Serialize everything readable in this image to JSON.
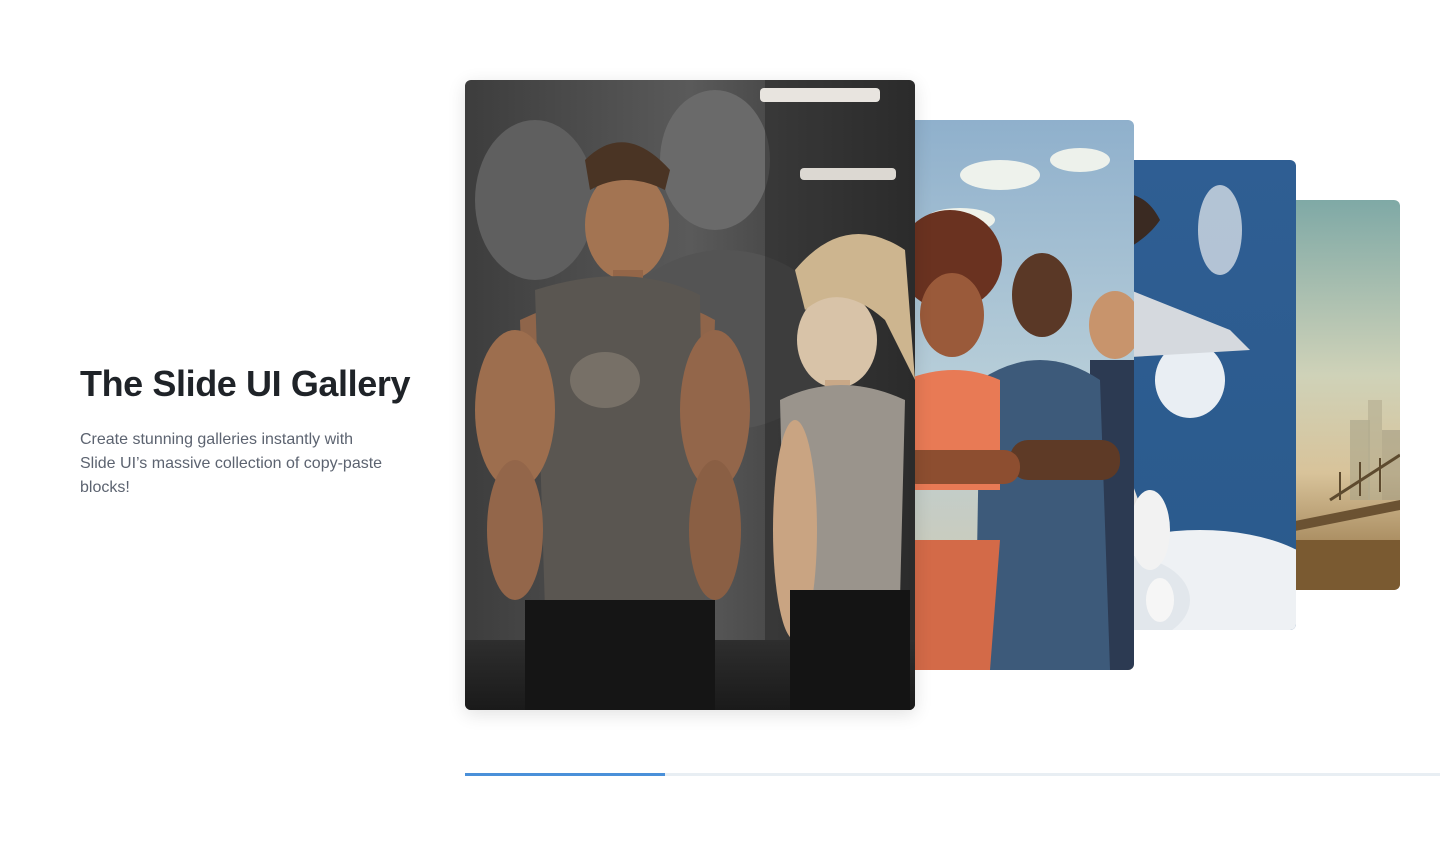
{
  "gallery": {
    "title": "The Slide UI Gallery",
    "description": "Create stunning galleries instantly with Slide UI’s massive collection of copy-paste blocks!",
    "slides": [
      {
        "icon": "gym-couple-photo",
        "alt": ""
      },
      {
        "icon": "athletes-group-photo",
        "alt": ""
      },
      {
        "icon": "jumping-runner-photo",
        "alt": ""
      },
      {
        "icon": "city-bridge-photo",
        "alt": ""
      }
    ],
    "progress": 0.205
  },
  "colors": {
    "title": "#1f2328",
    "text": "#5c6370",
    "progress_fill": "#4a90d9",
    "progress_track": "#e8eef3"
  }
}
